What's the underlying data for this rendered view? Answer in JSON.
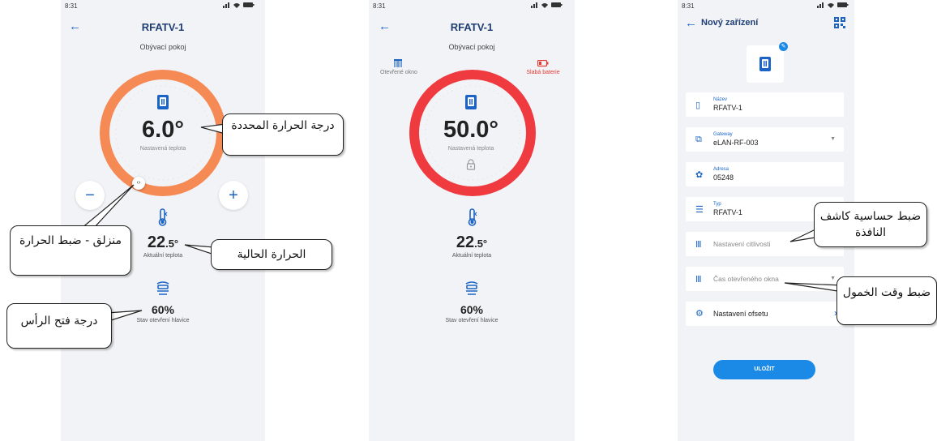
{
  "screens": [
    {
      "status_time": "8:31",
      "title": "RFATV-1",
      "subtitle": "Obývací pokoj",
      "set_temp": "6.0°",
      "set_temp_label": "Nastavená teplota",
      "current_temp_main": "22",
      "current_temp_frac": ".5°",
      "current_temp_label": "Aktuální teplota",
      "opening_value": "60%",
      "opening_label": "Stav otevření hlavice",
      "minus_label": "−",
      "plus_label": "+"
    },
    {
      "status_time": "8:31",
      "title": "RFATV-1",
      "subtitle": "Obývací pokoj",
      "window_status": "Otevřené okno",
      "battery_status": "Slabá baterie",
      "set_temp": "50.0°",
      "set_temp_label": "Nastavená teplota",
      "current_temp_main": "22",
      "current_temp_frac": ".5°",
      "current_temp_label": "Aktuální teplota",
      "opening_value": "60%",
      "opening_label": "Stav otevření hlavice"
    },
    {
      "status_time": "8:31",
      "title": "Nový zařízení",
      "fields": [
        {
          "label": "Název",
          "value": "RFATV-1",
          "icon": "device-icon"
        },
        {
          "label": "Gateway",
          "value": "eLAN-RF-003",
          "icon": "gateway-icon",
          "dropdown": true
        },
        {
          "label": "Adresa",
          "value": "05248",
          "icon": "address-icon"
        },
        {
          "label": "Typ",
          "value": "RFATV-1",
          "icon": "list-icon"
        },
        {
          "placeholder": "Nastavení citlivosti",
          "icon": "radiator-icon"
        },
        {
          "placeholder": "Čas otevřeného okna",
          "icon": "radiator-icon",
          "dropdown": true
        },
        {
          "value": "Nastavení ofsetu",
          "icon": "gear-icon",
          "chevron": true
        }
      ],
      "save_label": "ULOŽIT"
    }
  ],
  "callouts": {
    "set_temp": "درجة الحرارة المحددة",
    "slider": "منزلق - ضبط الحرارة",
    "current_temp": "الحرارة الحالية",
    "opening": "درجة فتح الرأس",
    "sensitivity": "ضبط حساسية كاشف النافذة",
    "delay": "ضبط وقت الخمول"
  },
  "colors": {
    "accent": "#1b64c5",
    "ring_orange": "#f58a55",
    "ring_red": "#ef3b40",
    "button_blue": "#1b8ae6",
    "battery_red": "#e53935"
  }
}
